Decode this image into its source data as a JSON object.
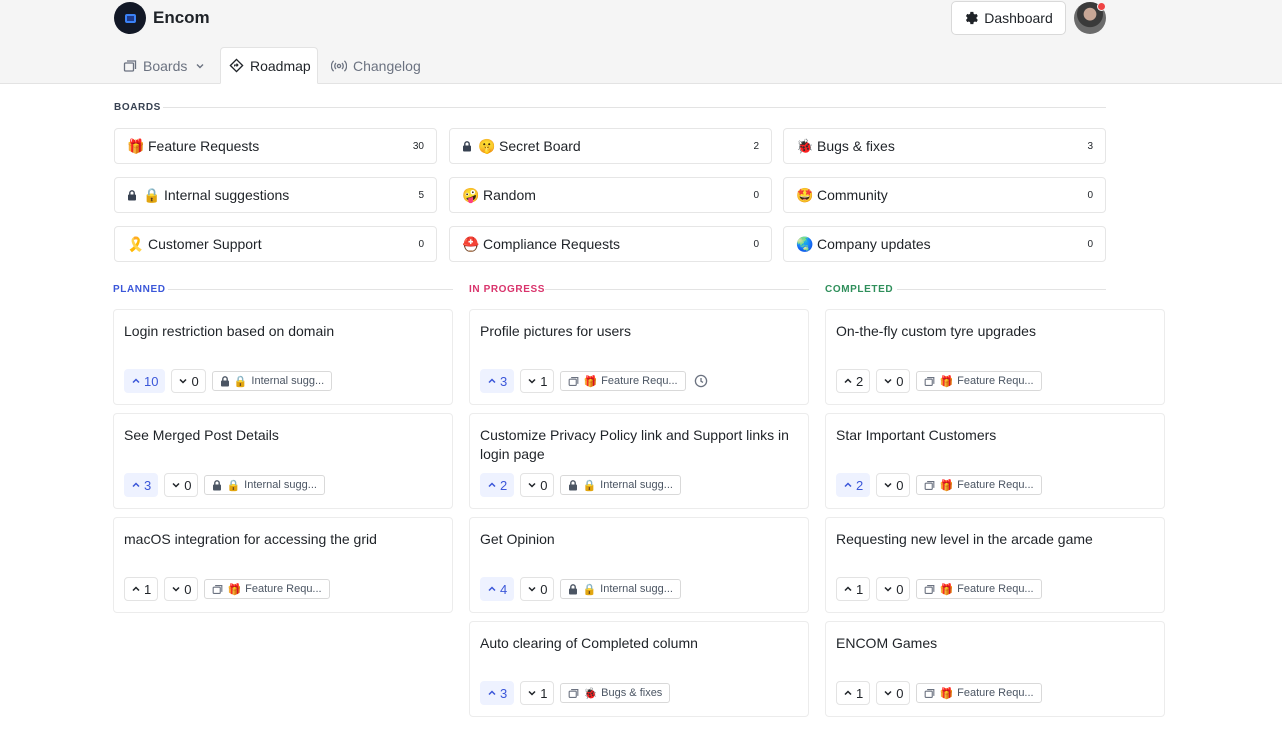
{
  "app": {
    "name": "Encom"
  },
  "header": {
    "dashboard_label": "Dashboard"
  },
  "tabs": {
    "boards": "Boards",
    "roadmap": "Roadmap",
    "changelog": "Changelog"
  },
  "boards_section": {
    "label": "BOARDS",
    "items": [
      {
        "emoji": "🎁",
        "locked": false,
        "name": "Feature Requests",
        "count": "30"
      },
      {
        "emoji": "🤫",
        "locked": true,
        "name": "Secret Board",
        "count": "2"
      },
      {
        "emoji": "🐞",
        "locked": false,
        "name": "Bugs & fixes",
        "count": "3"
      },
      {
        "emoji": "🔒",
        "locked": true,
        "name": "Internal suggestions",
        "count": "5"
      },
      {
        "emoji": "🤪",
        "locked": false,
        "name": "Random",
        "count": "0"
      },
      {
        "emoji": "🤩",
        "locked": false,
        "name": "Community",
        "count": "0"
      },
      {
        "emoji": "🎗️",
        "locked": false,
        "name": "Customer Support",
        "count": "0"
      },
      {
        "emoji": "⛑️",
        "locked": false,
        "name": "Compliance Requests",
        "count": "0"
      },
      {
        "emoji": "🌏",
        "locked": false,
        "name": "Company updates",
        "count": "0"
      }
    ]
  },
  "roadmap": {
    "columns": [
      {
        "label": "PLANNED",
        "color": "#3b57d9",
        "cards": [
          {
            "title": "Login restriction based on domain",
            "up": "10",
            "up_active": true,
            "down": "0",
            "board_locked": true,
            "board_emoji": "🔒",
            "board_label": "Internal sugg...",
            "clock": false
          },
          {
            "title": "See Merged Post Details",
            "up": "3",
            "up_active": true,
            "down": "0",
            "board_locked": true,
            "board_emoji": "🔒",
            "board_label": "Internal sugg...",
            "clock": false
          },
          {
            "title": "macOS integration for accessing the grid",
            "up": "1",
            "up_active": false,
            "down": "0",
            "board_locked": false,
            "board_emoji": "🎁",
            "board_label": "Feature Requ...",
            "clock": false
          }
        ]
      },
      {
        "label": "IN PROGRESS",
        "color": "#d9346c",
        "cards": [
          {
            "title": "Profile pictures for users",
            "up": "3",
            "up_active": true,
            "down": "1",
            "board_locked": false,
            "board_emoji": "🎁",
            "board_label": "Feature Requ...",
            "clock": true
          },
          {
            "title": "Customize Privacy Policy link and Support links in login page",
            "up": "2",
            "up_active": true,
            "down": "0",
            "board_locked": true,
            "board_emoji": "🔒",
            "board_label": "Internal sugg...",
            "clock": false
          },
          {
            "title": "Get Opinion",
            "up": "4",
            "up_active": true,
            "down": "0",
            "board_locked": true,
            "board_emoji": "🔒",
            "board_label": "Internal sugg...",
            "clock": false
          },
          {
            "title": "Auto clearing of Completed column",
            "up": "3",
            "up_active": true,
            "down": "1",
            "board_locked": false,
            "board_emoji": "🐞",
            "board_label": "Bugs & fixes",
            "clock": false
          }
        ]
      },
      {
        "label": "COMPLETED",
        "color": "#2f8f5b",
        "cards": [
          {
            "title": "On-the-fly custom tyre upgrades",
            "up": "2",
            "up_active": false,
            "down": "0",
            "board_locked": false,
            "board_emoji": "🎁",
            "board_label": "Feature Requ...",
            "clock": false
          },
          {
            "title": "Star Important Customers",
            "up": "2",
            "up_active": true,
            "down": "0",
            "board_locked": false,
            "board_emoji": "🎁",
            "board_label": "Feature Requ...",
            "clock": false
          },
          {
            "title": "Requesting new level in the arcade game",
            "up": "1",
            "up_active": false,
            "down": "0",
            "board_locked": false,
            "board_emoji": "🎁",
            "board_label": "Feature Requ...",
            "clock": false
          },
          {
            "title": "ENCOM Games",
            "up": "1",
            "up_active": false,
            "down": "0",
            "board_locked": false,
            "board_emoji": "🎁",
            "board_label": "Feature Requ...",
            "clock": false
          }
        ]
      }
    ]
  }
}
